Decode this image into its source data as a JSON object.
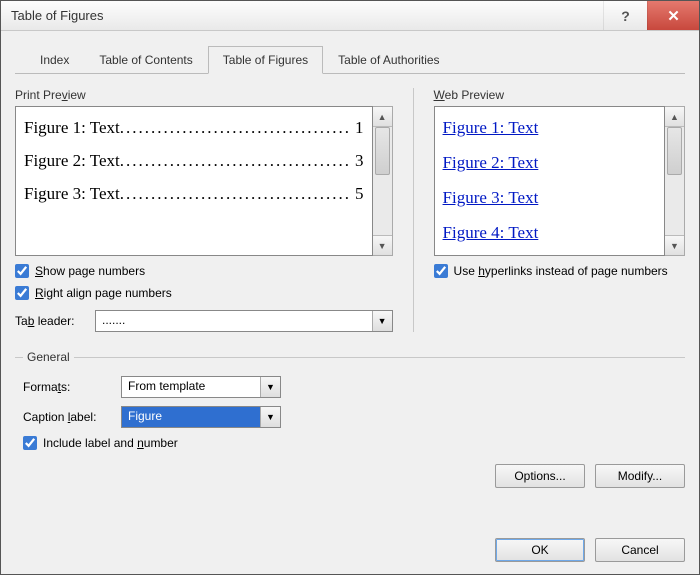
{
  "window": {
    "title": "Table of Figures"
  },
  "tabs": {
    "index": "Index",
    "toc": "Table of Contents",
    "tof": "Table of Figures",
    "toa": "Table of Authorities"
  },
  "print_preview": {
    "label": "Print Preview",
    "rows": [
      {
        "label": "Figure 1: Text",
        "page": "1"
      },
      {
        "label": "Figure 2: Text",
        "page": "3"
      },
      {
        "label": "Figure 3: Text",
        "page": "5"
      }
    ],
    "show_page_numbers": "Show page numbers",
    "right_align": "Right align page numbers",
    "tab_leader_label": "Tab leader:",
    "tab_leader_value": "......."
  },
  "web_preview": {
    "label": "Web Preview",
    "rows": [
      "Figure 1: Text",
      "Figure 2: Text",
      "Figure 3: Text",
      "Figure 4: Text"
    ],
    "use_hyperlinks": "Use hyperlinks instead of page numbers"
  },
  "general": {
    "legend": "General",
    "formats_label": "Formats:",
    "formats_value": "From template",
    "caption_label_label": "Caption label:",
    "caption_label_value": "Figure",
    "include_label": "Include label and number"
  },
  "buttons": {
    "options": "Options...",
    "modify": "Modify...",
    "ok": "OK",
    "cancel": "Cancel"
  }
}
